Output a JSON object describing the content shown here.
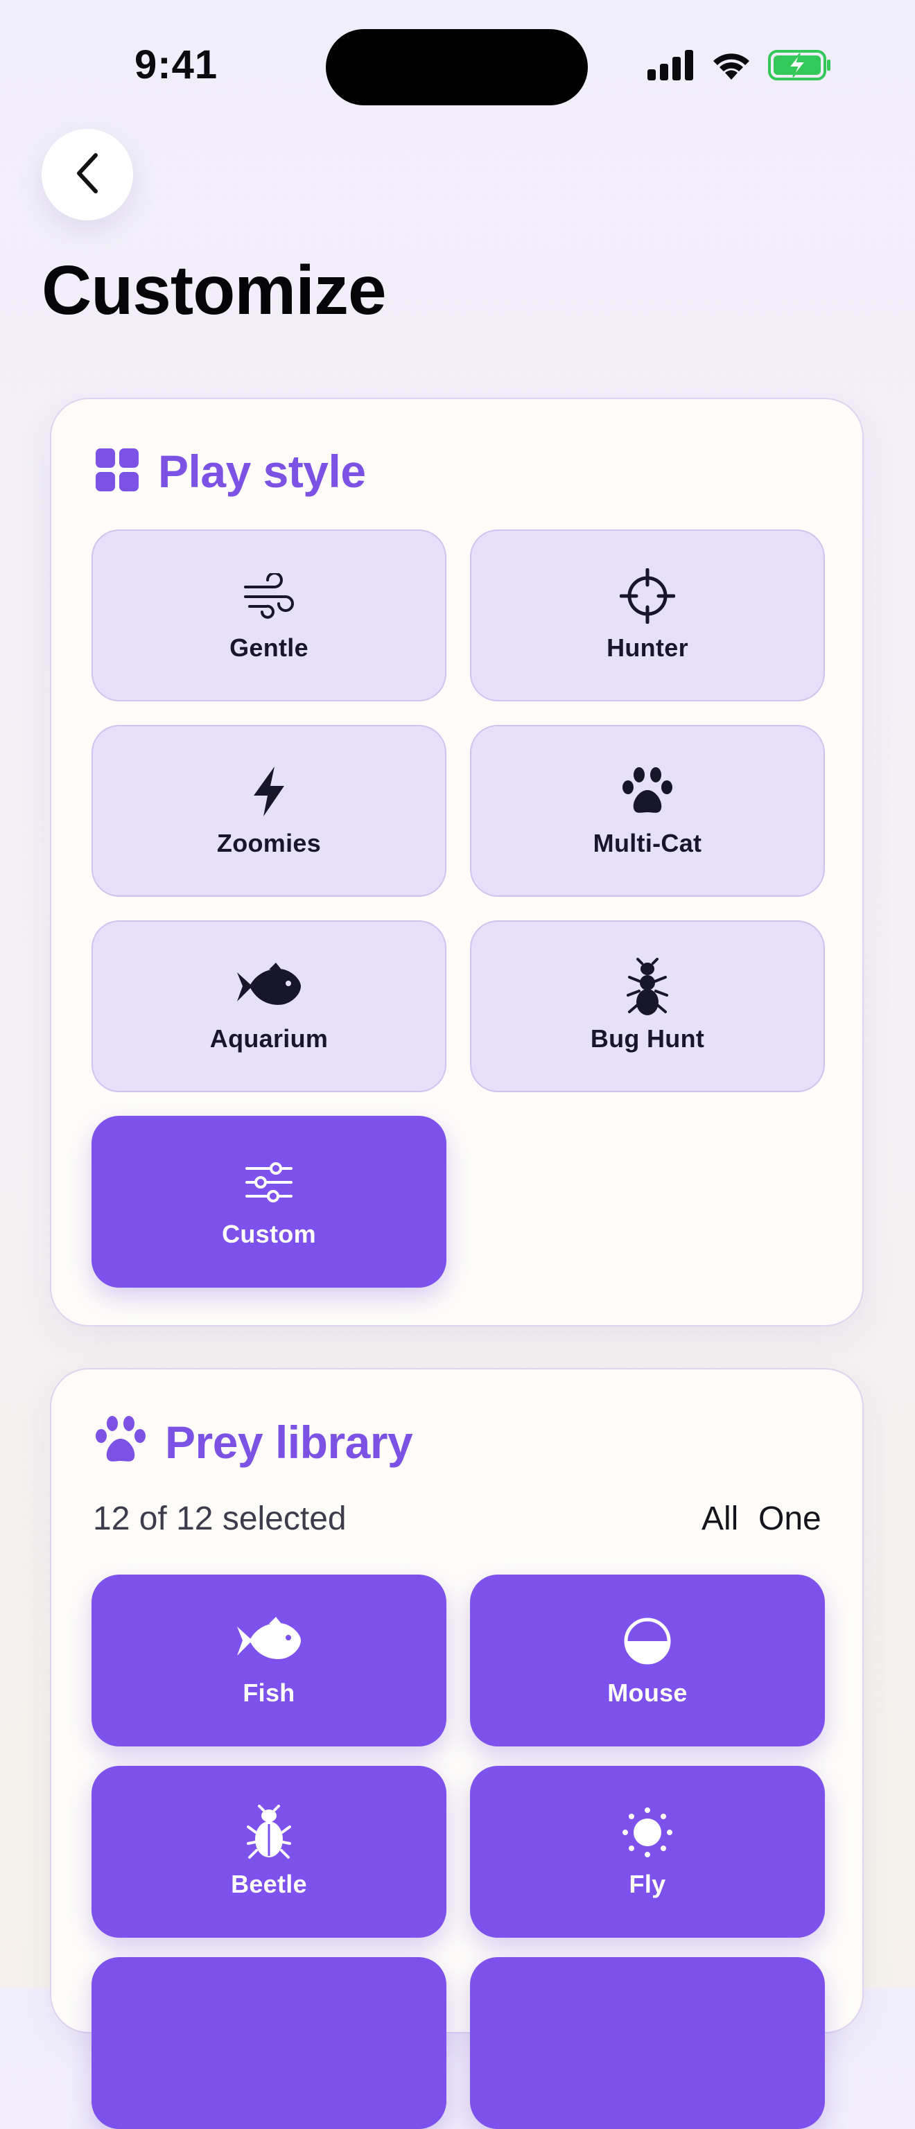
{
  "status_bar": {
    "time": "9:41",
    "icons": [
      "cellular-signal-icon",
      "wifi-icon",
      "battery-charging-icon"
    ],
    "battery_color": "#34c759"
  },
  "nav": {
    "back_icon": "chevron-left-icon"
  },
  "page": {
    "title": "Customize"
  },
  "play_style": {
    "title": "Play style",
    "icon": "grid-icon",
    "options": [
      {
        "label": "Gentle",
        "icon": "wind-icon",
        "selected": false
      },
      {
        "label": "Hunter",
        "icon": "crosshair-icon",
        "selected": false
      },
      {
        "label": "Zoomies",
        "icon": "lightning-icon",
        "selected": false
      },
      {
        "label": "Multi-Cat",
        "icon": "paw-icon",
        "selected": false
      },
      {
        "label": "Aquarium",
        "icon": "fish-icon",
        "selected": false
      },
      {
        "label": "Bug Hunt",
        "icon": "ant-icon",
        "selected": false
      },
      {
        "label": "Custom",
        "icon": "sliders-icon",
        "selected": true
      }
    ]
  },
  "prey_library": {
    "title": "Prey library",
    "icon": "paw-icon",
    "count_text": "12 of 12 selected",
    "all_label": "All",
    "one_label": "One",
    "items": [
      {
        "label": "Fish",
        "icon": "fish-icon",
        "selected": true
      },
      {
        "label": "Mouse",
        "icon": "half-circle-icon",
        "selected": true
      },
      {
        "label": "Beetle",
        "icon": "beetle-icon",
        "selected": true
      },
      {
        "label": "Fly",
        "icon": "sun-icon",
        "selected": true
      }
    ]
  },
  "colors": {
    "accent": "#7d52ec",
    "tile_light": "#e6e0fa",
    "title_purple": "#7b52e4"
  }
}
